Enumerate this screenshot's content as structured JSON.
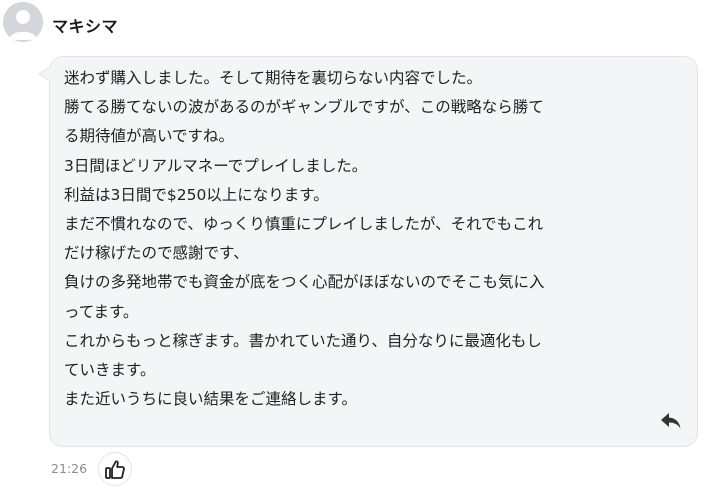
{
  "comment": {
    "author": "マキシマ",
    "time": "21:26",
    "lines": [
      "迷わず購入しました。そして期待を裏切らない内容でした。",
      "勝てる勝てないの波があるのがギャンブルですが、この戦略なら勝て",
      "る期待値が高いですね。",
      "3日間ほどリアルマネーでプレイしました。",
      "利益は3日間で$250以上になります。",
      "まだ不慣れなので、ゆっくり慎重にプレイしましたが、それでもこれ",
      "だけ稼げたので感謝です、",
      "負けの多発地帯でも資金が底をつく心配がほぼないのでそこも気に入",
      "ってます。",
      "これからもっと稼ぎます。書かれていた通り、自分なりに最適化もし",
      "ていきます。",
      "また近いうちに良い結果をご連絡します。"
    ]
  },
  "icons": {
    "avatar": "default-user-avatar",
    "reply": "reply-arrow-icon",
    "like": "thumbs-up-icon"
  },
  "colors": {
    "bubble_bg": "#f4f5f7",
    "bubble_border": "#e3e5e8",
    "text": "#222222",
    "time": "#8a8d93"
  }
}
